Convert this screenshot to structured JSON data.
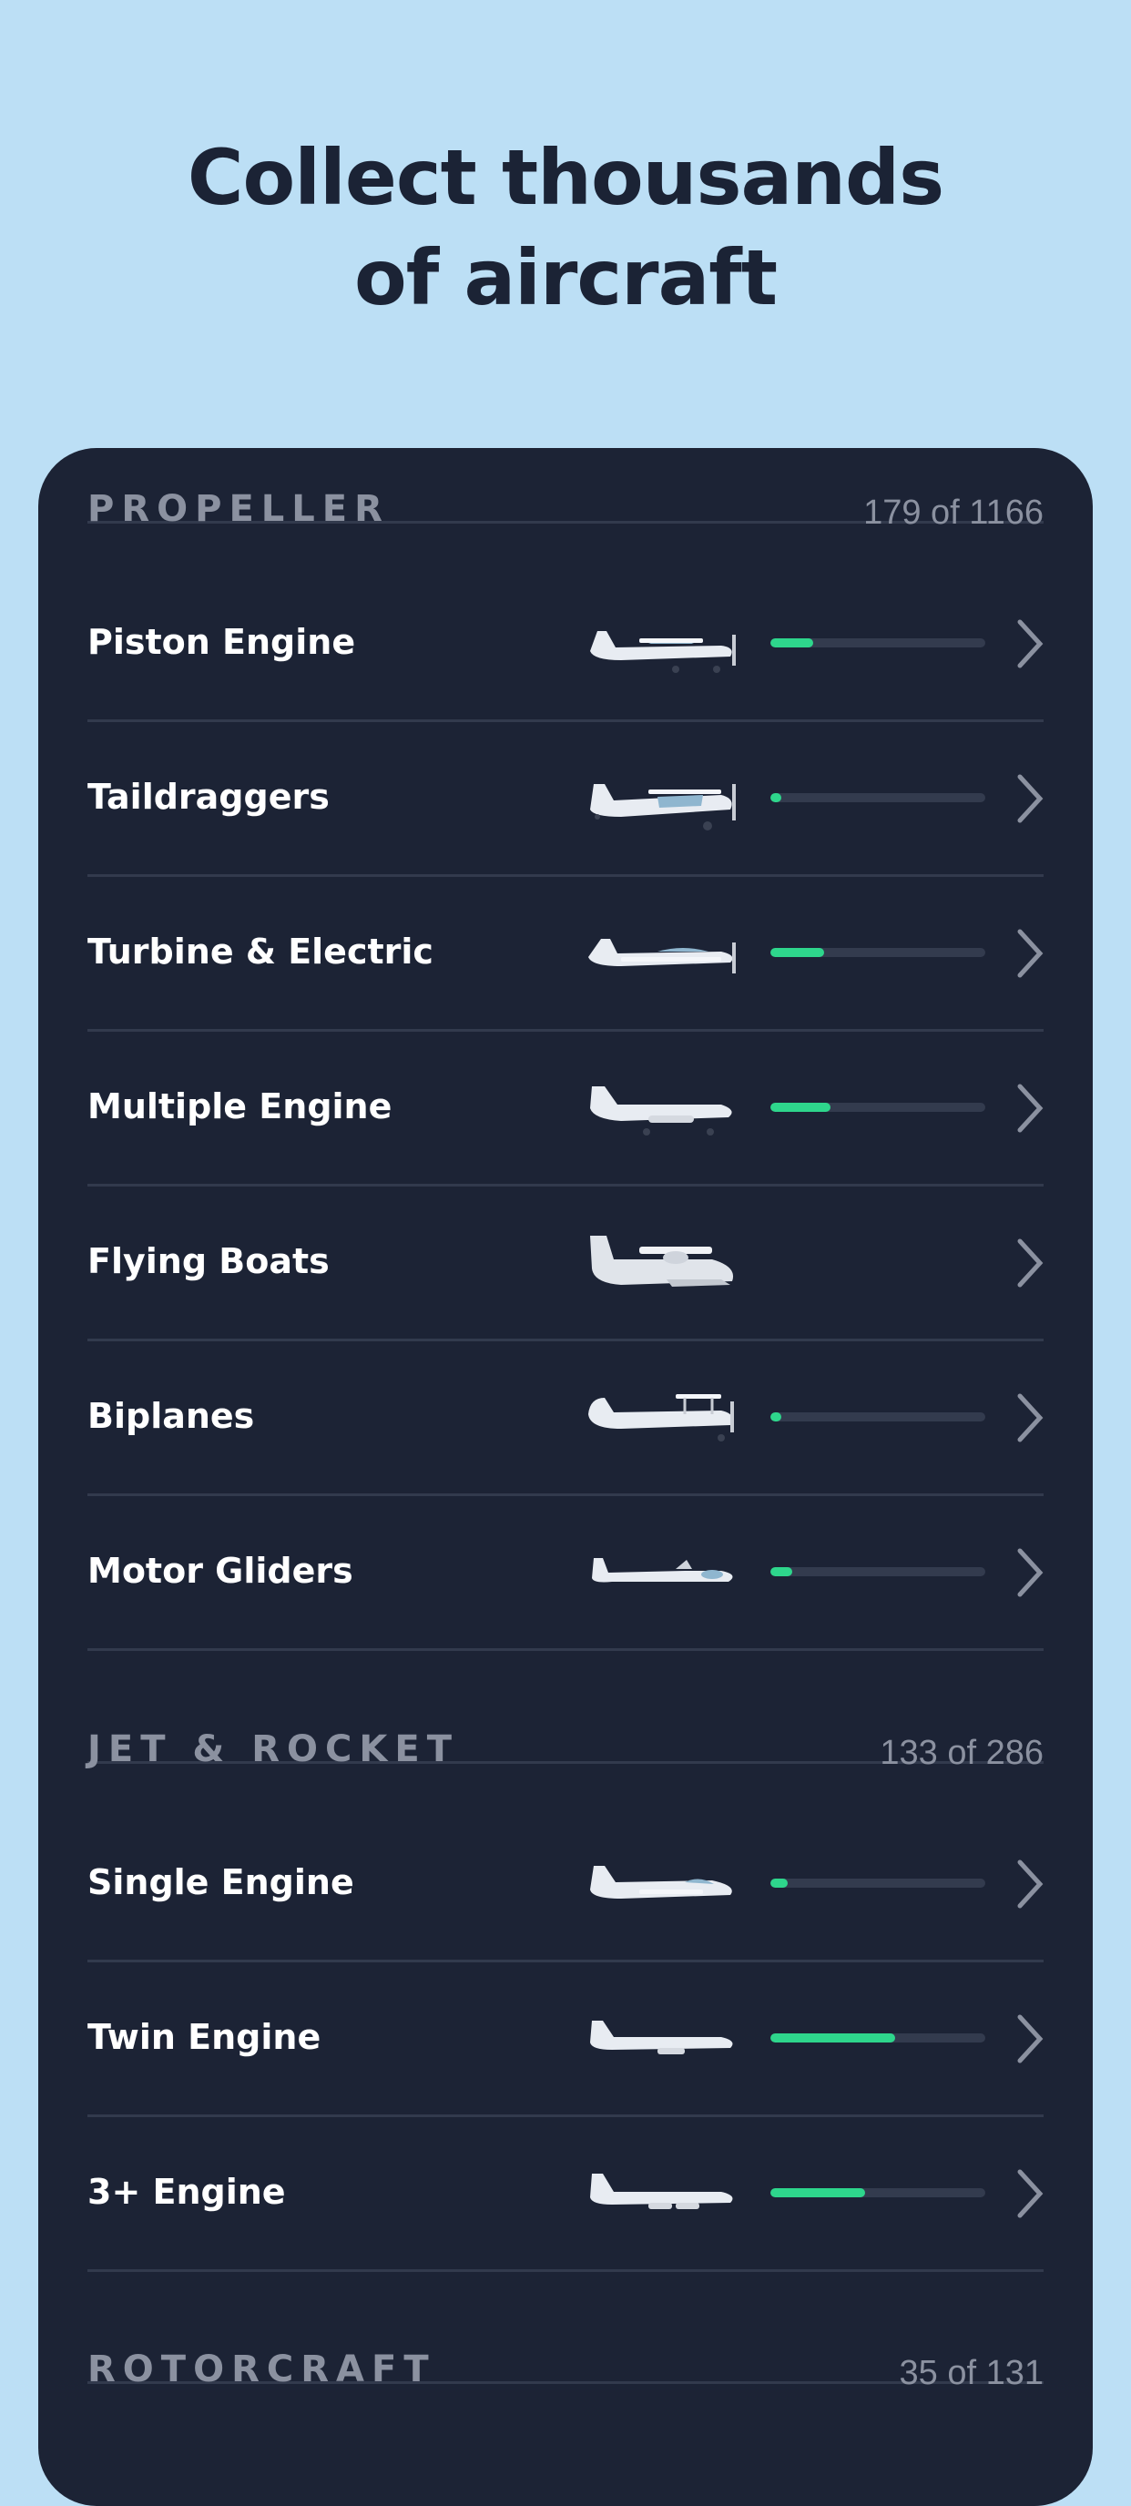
{
  "headline": {
    "line1": "Collect thousands",
    "line2": "of aircraft"
  },
  "sections": [
    {
      "title": "PROPELLER",
      "count": "179 of 1166",
      "items": [
        {
          "label": "Piston Engine",
          "progress": 0.2,
          "icon": "single-prop-plane-icon"
        },
        {
          "label": "Taildraggers",
          "progress": 0.05,
          "icon": "taildragger-plane-icon"
        },
        {
          "label": "Turbine & Electric",
          "progress": 0.25,
          "icon": "turbine-plane-icon"
        },
        {
          "label": "Multiple Engine",
          "progress": 0.28,
          "icon": "twin-prop-plane-icon"
        },
        {
          "label": "Flying Boats",
          "progress": null,
          "icon": "flying-boat-icon"
        },
        {
          "label": "Biplanes",
          "progress": 0.05,
          "icon": "biplane-icon"
        },
        {
          "label": "Motor Gliders",
          "progress": 0.1,
          "icon": "motor-glider-icon"
        }
      ]
    },
    {
      "title": "JET & ROCKET",
      "count": "133 of 286",
      "items": [
        {
          "label": "Single Engine",
          "progress": 0.08,
          "icon": "single-jet-icon"
        },
        {
          "label": "Twin Engine",
          "progress": 0.58,
          "icon": "twin-jet-icon"
        },
        {
          "label": "3+ Engine",
          "progress": 0.44,
          "icon": "airliner-jet-icon"
        }
      ]
    },
    {
      "title": "ROTORCRAFT",
      "count": "35 of 131",
      "items": []
    }
  ],
  "colors": {
    "background": "#bcdff5",
    "card": "#1c2335",
    "accent_progress": "#2ed68c",
    "muted_text": "#8b91a0"
  }
}
